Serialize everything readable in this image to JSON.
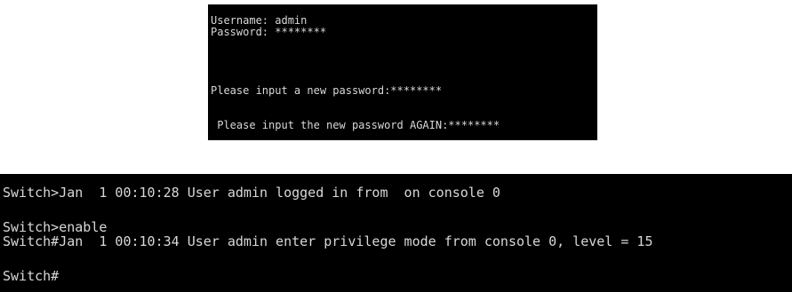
{
  "top_terminal": {
    "lines": [
      "Username: admin",
      "Password: ********",
      "Please input a new password:********",
      " Please input the new password AGAIN:********"
    ]
  },
  "bottom_terminal": {
    "lines": [
      "Switch>Jan  1 00:10:28 User admin logged in from  on console 0",
      "Switch>enable",
      "Switch#Jan  1 00:10:34 User admin enter privilege mode from console 0, level = 15",
      "Switch#"
    ]
  },
  "colors": {
    "background": "#ffffff",
    "terminal_bg": "#000000",
    "terminal_text": "#d8d8d8"
  }
}
